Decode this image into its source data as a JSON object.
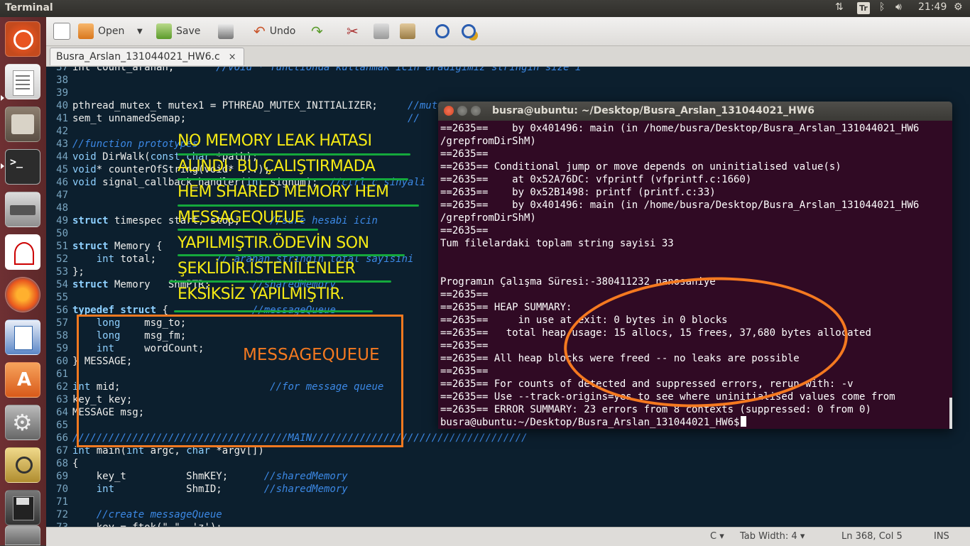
{
  "top_panel": {
    "app_title": "Terminal",
    "keyboard_indicator": "Tr",
    "clock": "21:49",
    "icons": [
      "network-updown-icon",
      "keyboard-layout-icon",
      "bluetooth-icon",
      "volume-icon",
      "power-gear-icon"
    ]
  },
  "launcher": {
    "items": [
      "ubuntu-dash-icon",
      "text-editor-icon",
      "file-manager-icon",
      "terminal-icon",
      "scanner-icon",
      "document-viewer-icon",
      "firefox-icon",
      "writer-icon",
      "software-center-icon",
      "system-settings-icon",
      "image-viewer-icon",
      "save-floppy-icon",
      "trash-icon"
    ]
  },
  "toolbar": {
    "open_label": "Open",
    "save_label": "Save",
    "undo_label": "Undo"
  },
  "tab": {
    "filename": "Busra_Arslan_131044021_HW6.c",
    "close": "×"
  },
  "statusbar": {
    "language": "C",
    "tab_width": "Tab Width: 4",
    "position": "Ln 368, Col 5",
    "mode": "INS"
  },
  "terminal": {
    "title": "busra@ubuntu: ~/Desktop/Busra_Arslan_131044021_HW6",
    "lines": [
      "==2635==    by 0x401496: main (in /home/busra/Desktop/Busra_Arslan_131044021_HW6",
      "/grepfromDirShM)",
      "==2635==",
      "==2635== Conditional jump or move depends on uninitialised value(s)",
      "==2635==    at 0x52A76DC: vfprintf (vfprintf.c:1660)",
      "==2635==    by 0x52B1498: printf (printf.c:33)",
      "==2635==    by 0x401496: main (in /home/busra/Desktop/Busra_Arslan_131044021_HW6",
      "/grepfromDirShM)",
      "==2635==",
      "Tum filelardaki toplam string sayisi 33",
      "",
      "",
      "Programın Çalışma Süresi:-380411232 nanosaniye",
      "==2635==",
      "==2635== HEAP SUMMARY:",
      "==2635==     in use at exit: 0 bytes in 0 blocks",
      "==2635==   total heap usage: 15 allocs, 15 frees, 37,680 bytes allocated",
      "==2635==",
      "==2635== All heap blocks were freed -- no leaks are possible",
      "==2635==",
      "==2635== For counts of detected and suppressed errors, rerun with: -v",
      "==2635== Use --track-origins=yes to see where uninitialised values come from",
      "==2635== ERROR SUMMARY: 23 errors from 8 contexts (suppressed: 0 from 0)"
    ],
    "prompt": "busra@ubuntu:~/Desktop/Busra_Arslan_131044021_HW6$"
  },
  "code": {
    "lines": [
      {
        "n": "37",
        "parts": [
          {
            "t": "int count_aranan;       ",
            "c": ""
          },
          {
            "t": "//void * functionda kullanmak icin aradigimiz stringin size'i",
            "c": "cm"
          }
        ]
      },
      {
        "n": "38",
        "parts": []
      },
      {
        "n": "39",
        "parts": []
      },
      {
        "n": "40",
        "parts": [
          {
            "t": "pthread_mutex_t mutex1 = PTHREAD_MUTEX_INITIALIZER;     ",
            "c": ""
          },
          {
            "t": "//mutex",
            "c": "cm"
          }
        ]
      },
      {
        "n": "41",
        "parts": [
          {
            "t": "sem_t unnamedSemap;                                     ",
            "c": ""
          },
          {
            "t": "//",
            "c": "cm"
          }
        ]
      },
      {
        "n": "42",
        "parts": []
      },
      {
        "n": "43",
        "parts": [
          {
            "t": "//function prototypes",
            "c": "cm"
          }
        ]
      },
      {
        "n": "44",
        "parts": [
          {
            "t": "void",
            "c": "ty"
          },
          {
            "t": " DirWalk(",
            "c": ""
          },
          {
            "t": "const char",
            "c": "ty"
          },
          {
            "t": " *path);",
            "c": ""
          }
        ]
      },
      {
        "n": "45",
        "parts": [
          {
            "t": "void",
            "c": "ty"
          },
          {
            "t": "* counterOfString(void* ...);",
            "c": ""
          }
        ]
      },
      {
        "n": "46",
        "parts": [
          {
            "t": "void",
            "c": "ty"
          },
          {
            "t": " signal_callback_handler(",
            "c": ""
          },
          {
            "t": "int",
            "c": "ty"
          },
          {
            "t": " signum);  ",
            "c": ""
          },
          {
            "t": "//ctrl_c sinyali",
            "c": "cm"
          }
        ]
      },
      {
        "n": "47",
        "parts": []
      },
      {
        "n": "48",
        "parts": []
      },
      {
        "n": "49",
        "parts": [
          {
            "t": "struct",
            "c": "kw"
          },
          {
            "t": " timespec start, stop;     ",
            "c": ""
          },
          {
            "t": "//sure hesabi icin",
            "c": "cm"
          }
        ]
      },
      {
        "n": "50",
        "parts": []
      },
      {
        "n": "51",
        "parts": [
          {
            "t": "struct",
            "c": "kw"
          },
          {
            "t": " Memory {",
            "c": ""
          }
        ]
      },
      {
        "n": "52",
        "parts": [
          {
            "t": "    ",
            "c": ""
          },
          {
            "t": "int",
            "c": "ty"
          },
          {
            "t": " total;          ",
            "c": ""
          },
          {
            "t": "// aranan stringin total sayisini",
            "c": "cm"
          }
        ]
      },
      {
        "n": "53",
        "parts": [
          {
            "t": "};",
            "c": ""
          }
        ]
      },
      {
        "n": "54",
        "parts": [
          {
            "t": "struct",
            "c": "kw"
          },
          {
            "t": " Memory   ShmPTR;       ",
            "c": ""
          },
          {
            "t": "//sharedMemory",
            "c": "cm"
          }
        ]
      },
      {
        "n": "55",
        "parts": []
      },
      {
        "n": "56",
        "parts": [
          {
            "t": "typedef struct",
            "c": "kw"
          },
          {
            "t": " {              ",
            "c": ""
          },
          {
            "t": "//messageQueue",
            "c": "cm"
          }
        ]
      },
      {
        "n": "57",
        "parts": [
          {
            "t": "    ",
            "c": ""
          },
          {
            "t": "long",
            "c": "ty"
          },
          {
            "t": "    msg_to;",
            "c": ""
          }
        ]
      },
      {
        "n": "58",
        "parts": [
          {
            "t": "    ",
            "c": ""
          },
          {
            "t": "long",
            "c": "ty"
          },
          {
            "t": "    msg_fm;",
            "c": ""
          }
        ]
      },
      {
        "n": "59",
        "parts": [
          {
            "t": "    ",
            "c": ""
          },
          {
            "t": "int",
            "c": "ty"
          },
          {
            "t": "     wordCount;",
            "c": ""
          }
        ]
      },
      {
        "n": "60",
        "parts": [
          {
            "t": "} MESSAGE;",
            "c": ""
          }
        ]
      },
      {
        "n": "61",
        "parts": []
      },
      {
        "n": "62",
        "parts": [
          {
            "t": "int",
            "c": "ty"
          },
          {
            "t": " mid;                         ",
            "c": ""
          },
          {
            "t": "//for message queue",
            "c": "cm"
          }
        ]
      },
      {
        "n": "63",
        "parts": [
          {
            "t": "key_t key;",
            "c": ""
          }
        ]
      },
      {
        "n": "64",
        "parts": [
          {
            "t": "MESSAGE msg;",
            "c": ""
          }
        ]
      },
      {
        "n": "65",
        "parts": []
      },
      {
        "n": "66",
        "parts": [
          {
            "t": "////////////////////////////////////MAIN////////////////////////////////////",
            "c": "cm"
          }
        ]
      },
      {
        "n": "67",
        "parts": [
          {
            "t": "int",
            "c": "ty"
          },
          {
            "t": " main(",
            "c": ""
          },
          {
            "t": "int",
            "c": "ty"
          },
          {
            "t": " argc, ",
            "c": ""
          },
          {
            "t": "char",
            "c": "ty"
          },
          {
            "t": " *argv[])",
            "c": ""
          }
        ]
      },
      {
        "n": "68",
        "parts": [
          {
            "t": "{",
            "c": ""
          }
        ]
      },
      {
        "n": "69",
        "parts": [
          {
            "t": "    key_t          ShmKEY;      ",
            "c": ""
          },
          {
            "t": "//sharedMemory",
            "c": "cm"
          }
        ]
      },
      {
        "n": "70",
        "parts": [
          {
            "t": "    ",
            "c": ""
          },
          {
            "t": "int",
            "c": "ty"
          },
          {
            "t": "            ShmID;       ",
            "c": ""
          },
          {
            "t": "//sharedMemory",
            "c": "cm"
          }
        ]
      },
      {
        "n": "71",
        "parts": []
      },
      {
        "n": "72",
        "parts": [
          {
            "t": "    ",
            "c": ""
          },
          {
            "t": "//create messageQueue",
            "c": "cm"
          }
        ]
      },
      {
        "n": "73",
        "parts": [
          {
            "t": "    key = ftok(\".\", 'z');",
            "c": ""
          }
        ]
      }
    ]
  },
  "annotations": {
    "note_lines": [
      "NO MEMORY LEAK HATASI",
      "ALINDI. BU ÇALIŞTIRMADA",
      "HEM SHARED MEMORY HEM",
      "MESSAGEQUEUE",
      "YAPILMIŞTIR.ÖDEVİN SON",
      "ŞEKLİDİR.İSTENİLENLER",
      "EKSİKSİZ YAPILMIŞTIR."
    ],
    "box_label": "MESSAGEQUEUE",
    "highlight_color": "#f47920",
    "note_color": "#f5ea14",
    "underline_color": "#14a83c"
  }
}
